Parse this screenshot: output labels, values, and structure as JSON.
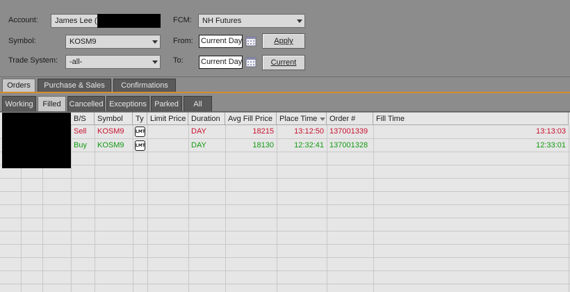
{
  "filters": {
    "account": {
      "label": "Account:",
      "value": "James Lee ("
    },
    "symbol": {
      "label": "Symbol:",
      "value": "KOSM9"
    },
    "trade_system": {
      "label": "Trade System:",
      "value": "-all-"
    },
    "fcm": {
      "label": "FCM:",
      "value": "NH Futures"
    },
    "from": {
      "label": "From:",
      "value": "Current Day"
    },
    "to": {
      "label": "To:",
      "value": "Current Day"
    },
    "apply_label": "Apply",
    "current_label": "Current"
  },
  "main_tabs": [
    {
      "label": "Orders",
      "active": true
    },
    {
      "label": "Purchase & Sales",
      "active": false
    },
    {
      "label": "Confirmations",
      "active": false
    }
  ],
  "sub_tabs": [
    {
      "label": "Working",
      "active": false
    },
    {
      "label": "Filled",
      "active": true
    },
    {
      "label": "Cancelled",
      "active": false
    },
    {
      "label": "Exceptions",
      "active": false
    },
    {
      "label": "Parked",
      "active": false
    },
    {
      "label": "All",
      "active": false
    }
  ],
  "table": {
    "columns": [
      "B/S",
      "Symbol",
      "Ty",
      "Limit Price",
      "Duration",
      "Avg Fill Price",
      "Place Time",
      "Order #",
      "Fill Time"
    ],
    "rows": [
      {
        "side": "Sell",
        "symbol": "KOSM9",
        "type_icon": "LMT",
        "limit_price": "",
        "duration": "DAY",
        "avg_fill_price": "18215",
        "place_time": "13:12:50",
        "order_no": "137001339",
        "fill_time": "13:13:03",
        "color": "#c8102e"
      },
      {
        "side": "Buy",
        "symbol": "KOSM9",
        "type_icon": "LMT",
        "limit_price": "",
        "duration": "DAY",
        "avg_fill_price": "18130",
        "place_time": "12:32:41",
        "order_no": "137001328",
        "fill_time": "12:33:01",
        "color": "#119911"
      }
    ]
  },
  "colors": {
    "sell": "#c8102e",
    "buy": "#119911",
    "accent": "#d98a2b"
  }
}
